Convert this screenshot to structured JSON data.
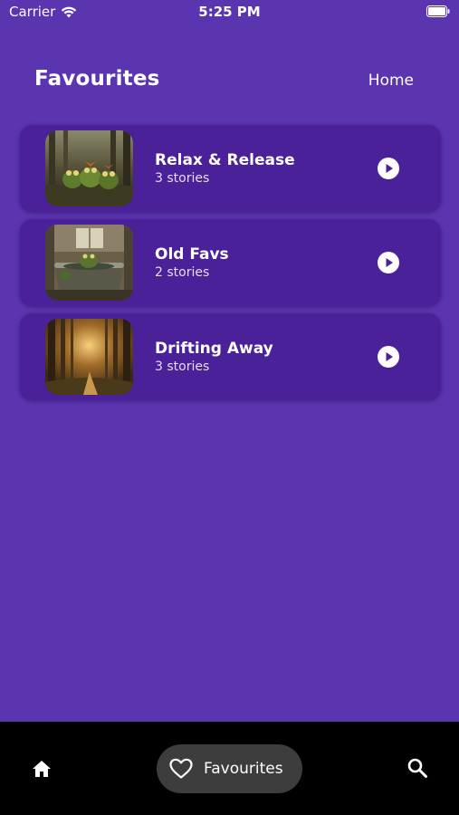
{
  "status_bar": {
    "carrier": "Carrier",
    "time": "5:25 PM",
    "icons": [
      "wifi-icon",
      "battery-icon"
    ]
  },
  "header": {
    "title": "Favourites",
    "home_link": "Home"
  },
  "favourites": [
    {
      "title": "Relax & Release",
      "subtitle": "3 stories",
      "image": "frogs-in-forest",
      "action_icon": "play-icon"
    },
    {
      "title": "Old Favs",
      "subtitle": "2 stories",
      "image": "frog-in-bathtub",
      "action_icon": "play-icon"
    },
    {
      "title": "Drifting Away",
      "subtitle": "3 stories",
      "image": "sunlit-forest-path",
      "action_icon": "play-icon"
    }
  ],
  "bottom_nav": {
    "items": [
      {
        "icon": "home-icon",
        "label": ""
      },
      {
        "icon": "heart-icon",
        "label": "Favourites",
        "selected": true
      },
      {
        "icon": "search-icon",
        "label": ""
      }
    ]
  },
  "colors": {
    "background": "#5b34b0",
    "card": "#4a2199",
    "nav_bar": "#000000",
    "nav_pill": "#3d3d3d",
    "text": "#ffffff"
  }
}
